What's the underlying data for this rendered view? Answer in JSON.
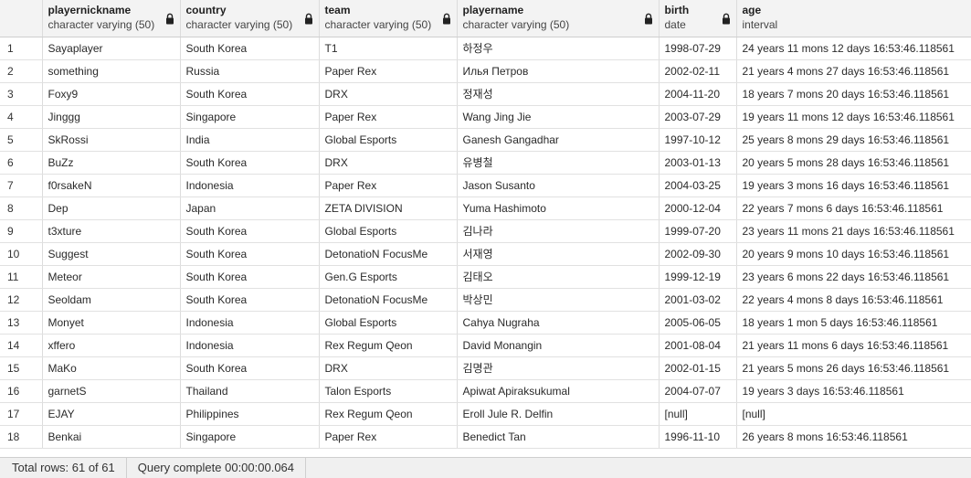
{
  "columns": [
    {
      "name": "",
      "type": ""
    },
    {
      "name": "playernickname",
      "type": "character varying (50)"
    },
    {
      "name": "country",
      "type": "character varying (50)"
    },
    {
      "name": "team",
      "type": "character varying (50)"
    },
    {
      "name": "playername",
      "type": "character varying (50)"
    },
    {
      "name": "birth",
      "type": "date"
    },
    {
      "name": "age",
      "type": "interval"
    }
  ],
  "rows": [
    [
      "1",
      "Sayaplayer",
      "South Korea",
      "T1",
      "하정우",
      "1998-07-29",
      "24 years 11 mons 12 days 16:53:46.118561"
    ],
    [
      "2",
      "something",
      "Russia",
      "Paper Rex",
      "Илья Петров",
      "2002-02-11",
      "21 years 4 mons 27 days 16:53:46.118561"
    ],
    [
      "3",
      "Foxy9",
      "South Korea",
      "DRX",
      "정재성",
      "2004-11-20",
      "18 years 7 mons 20 days 16:53:46.118561"
    ],
    [
      "4",
      "Jinggg",
      "Singapore",
      "Paper Rex",
      "Wang Jing Jie",
      "2003-07-29",
      "19 years 11 mons 12 days 16:53:46.118561"
    ],
    [
      "5",
      "SkRossi",
      "India",
      "Global Esports",
      "Ganesh Gangadhar",
      "1997-10-12",
      "25 years 8 mons 29 days 16:53:46.118561"
    ],
    [
      "6",
      "BuZz",
      "South Korea",
      "DRX",
      "유병철",
      "2003-01-13",
      "20 years 5 mons 28 days 16:53:46.118561"
    ],
    [
      "7",
      "f0rsakeN",
      "Indonesia",
      "Paper Rex",
      "Jason Susanto",
      "2004-03-25",
      "19 years 3 mons 16 days 16:53:46.118561"
    ],
    [
      "8",
      "Dep",
      "Japan",
      "ZETA DIVISION",
      "Yuma Hashimoto",
      "2000-12-04",
      "22 years 7 mons 6 days 16:53:46.118561"
    ],
    [
      "9",
      "t3xture",
      "South Korea",
      "Global Esports",
      "김나라",
      "1999-07-20",
      "23 years 11 mons 21 days 16:53:46.118561"
    ],
    [
      "10",
      "Suggest",
      "South Korea",
      "DetonatioN FocusMe",
      "서재영",
      "2002-09-30",
      "20 years 9 mons 10 days 16:53:46.118561"
    ],
    [
      "11",
      "Meteor",
      "South Korea",
      "Gen.G Esports",
      "김태오",
      "1999-12-19",
      "23 years 6 mons 22 days 16:53:46.118561"
    ],
    [
      "12",
      "Seoldam",
      "South Korea",
      "DetonatioN FocusMe",
      "박상민",
      "2001-03-02",
      "22 years 4 mons 8 days 16:53:46.118561"
    ],
    [
      "13",
      "Monyet",
      "Indonesia",
      "Global Esports",
      "Cahya Nugraha",
      "2005-06-05",
      "18 years 1 mon 5 days 16:53:46.118561"
    ],
    [
      "14",
      "xffero",
      "Indonesia",
      "Rex Regum Qeon",
      "David Monangin",
      "2001-08-04",
      "21 years 11 mons 6 days 16:53:46.118561"
    ],
    [
      "15",
      "MaKo",
      "South Korea",
      "DRX",
      "김명관",
      "2002-01-15",
      "21 years 5 mons 26 days 16:53:46.118561"
    ],
    [
      "16",
      "garnetS",
      "Thailand",
      "Talon Esports",
      "Apiwat Apiraksukumal",
      "2004-07-07",
      "19 years 3 days 16:53:46.118561"
    ],
    [
      "17",
      "EJAY",
      "Philippines",
      "Rex Regum Qeon",
      "Eroll Jule R. Delfin",
      "[null]",
      "[null]"
    ],
    [
      "18",
      "Benkai",
      "Singapore",
      "Paper Rex",
      "Benedict Tan",
      "1996-11-10",
      "26 years 8 mons 16:53:46.118561"
    ]
  ],
  "status": {
    "total_rows": "Total rows: 61 of 61",
    "query_complete": "Query complete 00:00:00.064"
  },
  "colors": {
    "header_bg": "#f3f3f3",
    "grid_line": "#dcdcdc",
    "null_text": "#b5b5b5",
    "status_bg": "#f0f0f0"
  },
  "icons": {
    "column_lock": "lock-icon"
  }
}
